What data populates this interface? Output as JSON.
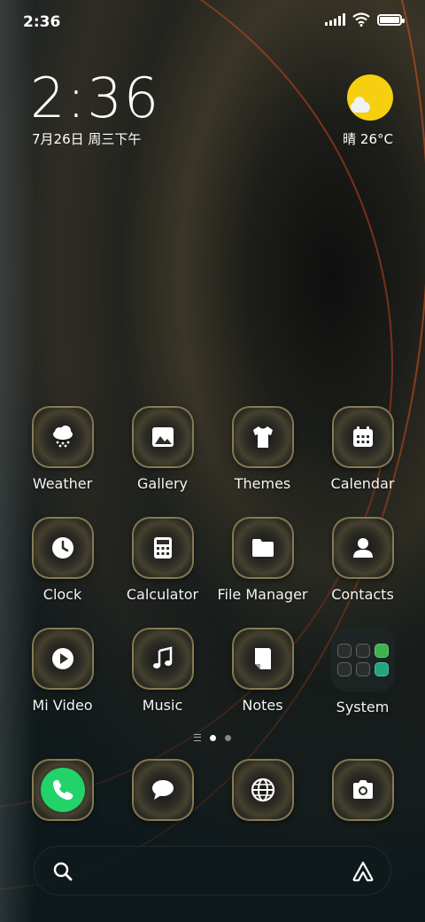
{
  "status": {
    "time": "2:36"
  },
  "lockscreen_widget": {
    "clock": "2:36",
    "date": "7月26日 周三下午",
    "weather": "晴 26°C"
  },
  "apps": [
    {
      "label": "Weather",
      "icon": "weather-icon"
    },
    {
      "label": "Gallery",
      "icon": "gallery-icon"
    },
    {
      "label": "Themes",
      "icon": "themes-icon"
    },
    {
      "label": "Calendar",
      "icon": "calendar-icon"
    },
    {
      "label": "Clock",
      "icon": "clock-icon"
    },
    {
      "label": "Calculator",
      "icon": "calculator-icon"
    },
    {
      "label": "File Manager",
      "icon": "folder-icon"
    },
    {
      "label": "Contacts",
      "icon": "contacts-icon"
    },
    {
      "label": "Mi Video",
      "icon": "play-icon"
    },
    {
      "label": "Music",
      "icon": "music-icon"
    },
    {
      "label": "Notes",
      "icon": "notes-icon"
    },
    {
      "label": "System",
      "icon": "folder-grid-icon"
    }
  ],
  "dock": [
    {
      "icon": "phone-icon"
    },
    {
      "icon": "messages-icon"
    },
    {
      "icon": "browser-icon"
    },
    {
      "icon": "camera-icon"
    }
  ],
  "colors": {
    "phone_green": "#22d36a",
    "sun_yellow": "#f6cf11",
    "wallpaper_accent": "#c8461e"
  }
}
